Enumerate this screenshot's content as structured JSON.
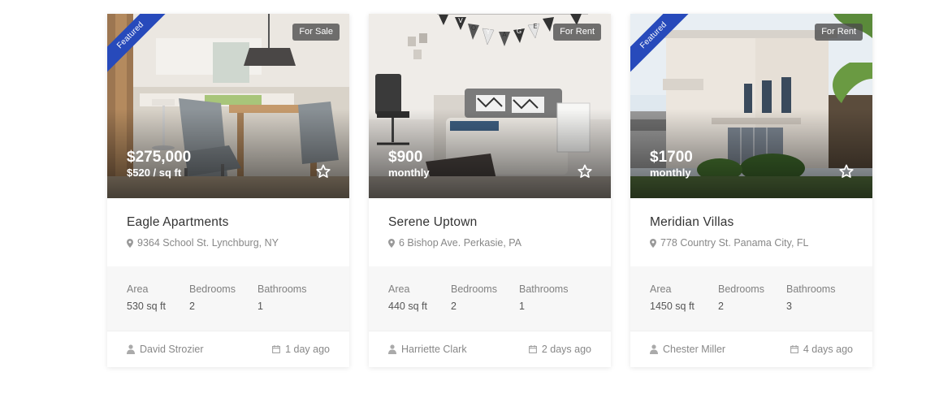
{
  "listings": [
    {
      "featured": true,
      "featured_label": "Featured",
      "tag": "For Sale",
      "price": "$275,000",
      "price_sub": "$520 / sq ft",
      "title": "Eagle Apartments",
      "address": "9364 School St. Lynchburg, NY",
      "specs": [
        {
          "label": "Area",
          "value": "530 sq ft"
        },
        {
          "label": "Bedrooms",
          "value": "2"
        },
        {
          "label": "Bathrooms",
          "value": "1"
        }
      ],
      "agent": "David Strozier",
      "date": "1 day ago"
    },
    {
      "featured": false,
      "tag": "For Rent",
      "price": "$900",
      "price_sub": "monthly",
      "title": "Serene Uptown",
      "address": "6 Bishop Ave. Perkasie, PA",
      "specs": [
        {
          "label": "Area",
          "value": "440 sq ft"
        },
        {
          "label": "Bedrooms",
          "value": "2"
        },
        {
          "label": "Bathrooms",
          "value": "1"
        }
      ],
      "agent": "Harriette Clark",
      "date": "2 days ago"
    },
    {
      "featured": true,
      "featured_label": "Featured",
      "tag": "For Rent",
      "price": "$1700",
      "price_sub": "monthly",
      "title": "Meridian Villas",
      "address": "778 Country St. Panama City, FL",
      "specs": [
        {
          "label": "Area",
          "value": "1450 sq ft"
        },
        {
          "label": "Bedrooms",
          "value": "2"
        },
        {
          "label": "Bathrooms",
          "value": "3"
        }
      ],
      "agent": "Chester Miller",
      "date": "4 days ago"
    }
  ],
  "banner_letters": [
    "V",
    "O",
    "Y",
    "A",
    "G",
    "E"
  ],
  "colors": {
    "featured_ribbon": "#274abb",
    "tag_bg": "#4a4a4a",
    "specs_bg": "#f7f7f7"
  },
  "icons": {
    "address": "map-marker-icon",
    "favorite": "star-outline-icon",
    "agent": "user-icon",
    "date": "calendar-icon"
  }
}
